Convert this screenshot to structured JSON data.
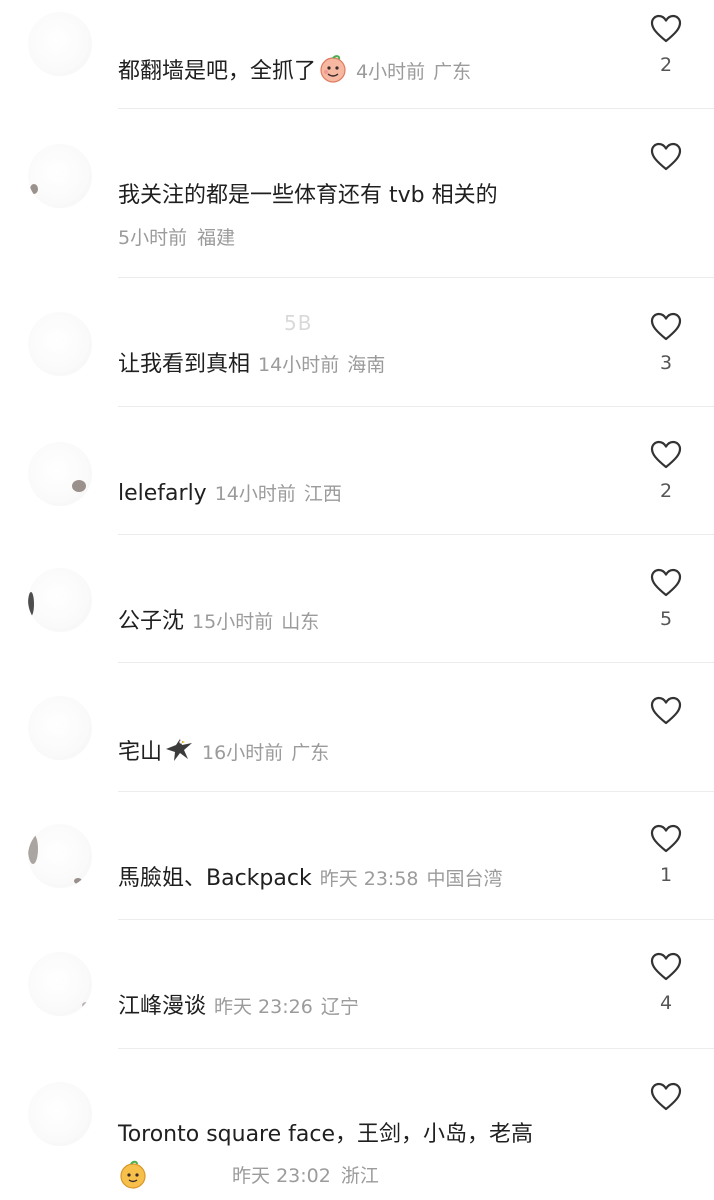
{
  "comments": [
    {
      "text": "都翻墙是吧，全抓了",
      "emoji": "peach-face-emoji",
      "time": "4小时前",
      "location": "广东",
      "likes": "2"
    },
    {
      "text": "我关注的都是一些体育还有 tvb 相关的",
      "time": "5小时前",
      "location": "福建",
      "likes": ""
    },
    {
      "ghost_name": "5B",
      "text": "让我看到真相",
      "time": "14小时前",
      "location": "海南",
      "likes": "3"
    },
    {
      "text": "lelefarly",
      "time": "14小时前",
      "location": "江西",
      "likes": "2"
    },
    {
      "text": "公子沈",
      "time": "15小时前",
      "location": "山东",
      "likes": "5"
    },
    {
      "text": "宅山",
      "emoji": "eagle-emoji",
      "time": "16小时前",
      "location": "广东",
      "likes": ""
    },
    {
      "text": "馬臉姐、Backpack",
      "time": "昨天 23:58",
      "location": "中国台湾",
      "likes": "1"
    },
    {
      "text": "江峰漫谈",
      "time": "昨天 23:26",
      "location": "辽宁",
      "likes": "4"
    },
    {
      "text": "Toronto square face，王剑，小岛，老高",
      "emoji": "mango-face-emoji",
      "time": "昨天 23:02",
      "location": "浙江",
      "likes": ""
    }
  ],
  "icons": {
    "like": "heart-outline-icon"
  },
  "colors": {
    "text": "#1f1f1f",
    "meta": "#9b9b9b",
    "divider": "#ececec"
  }
}
